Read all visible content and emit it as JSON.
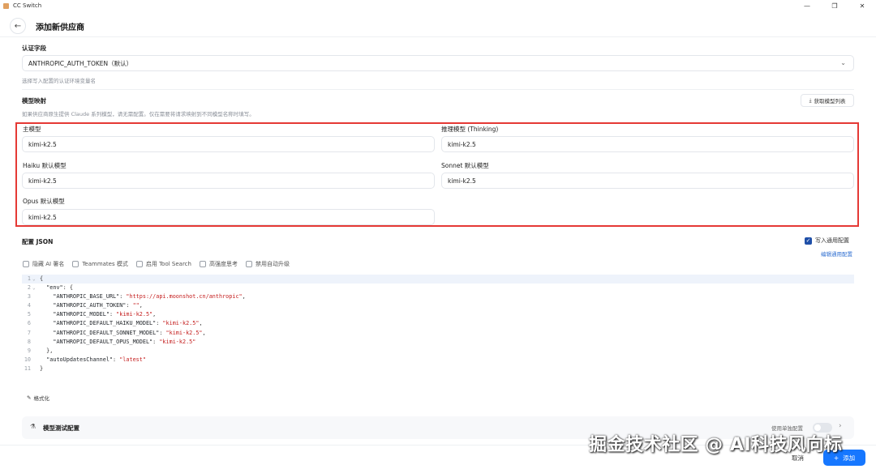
{
  "window": {
    "title": "CC Switch",
    "minimize": "—",
    "restore": "❐",
    "close": "✕"
  },
  "header": {
    "back_icon": "←",
    "title": "添加新供应商"
  },
  "auth": {
    "label": "认证字段",
    "selected": "ANTHROPIC_AUTH_TOKEN（默认）",
    "hint": "选择写入配置的认证环境变量名"
  },
  "mapping": {
    "label": "模型映射",
    "hint": "如果供应商原生提供 Claude 系列模型，请无需配置。仅在需要将请求映射到不同模型名称时填写。",
    "fetch_button": "获取模型列表",
    "fields": {
      "main": {
        "label": "主模型",
        "value": "kimi-k2.5"
      },
      "reasoning": {
        "label": "推理模型 (Thinking)",
        "value": "kimi-k2.5"
      },
      "haiku": {
        "label": "Haiku 默认模型",
        "value": "kimi-k2.5"
      },
      "sonnet": {
        "label": "Sonnet 默认模型",
        "value": "kimi-k2.5"
      },
      "opus": {
        "label": "Opus 默认模型",
        "value": "kimi-k2.5"
      }
    }
  },
  "config": {
    "label": "配置 JSON",
    "write_common": "写入通用配置",
    "edit_common": "编辑通用配置",
    "options": [
      "隐藏 AI 署名",
      "Teammates 模式",
      "启用 Tool Search",
      "高强度思考",
      "禁用自动升级"
    ],
    "code_lines": [
      {
        "n": "1",
        "fold": "⌄",
        "parts": [
          [
            "p",
            "{"
          ]
        ]
      },
      {
        "n": "2",
        "fold": "⌄",
        "parts": [
          [
            "p",
            "  "
          ],
          [
            "k",
            "\"env\""
          ],
          [
            "p",
            ": {"
          ]
        ]
      },
      {
        "n": "3",
        "fold": "",
        "parts": [
          [
            "p",
            "    "
          ],
          [
            "k",
            "\"ANTHROPIC_BASE_URL\""
          ],
          [
            "p",
            ": "
          ],
          [
            "s",
            "\"https://api.moonshot.cn/anthropic\""
          ],
          [
            "p",
            ","
          ]
        ]
      },
      {
        "n": "4",
        "fold": "",
        "parts": [
          [
            "p",
            "    "
          ],
          [
            "k",
            "\"ANTHROPIC_AUTH_TOKEN\""
          ],
          [
            "p",
            ": "
          ],
          [
            "s",
            "\"\""
          ],
          [
            "p",
            ","
          ]
        ]
      },
      {
        "n": "5",
        "fold": "",
        "parts": [
          [
            "p",
            "    "
          ],
          [
            "k",
            "\"ANTHROPIC_MODEL\""
          ],
          [
            "p",
            ": "
          ],
          [
            "s",
            "\"kimi-k2.5\""
          ],
          [
            "p",
            ","
          ]
        ]
      },
      {
        "n": "6",
        "fold": "",
        "parts": [
          [
            "p",
            "    "
          ],
          [
            "k",
            "\"ANTHROPIC_DEFAULT_HAIKU_MODEL\""
          ],
          [
            "p",
            ": "
          ],
          [
            "s",
            "\"kimi-k2.5\""
          ],
          [
            "p",
            ","
          ]
        ]
      },
      {
        "n": "7",
        "fold": "",
        "parts": [
          [
            "p",
            "    "
          ],
          [
            "k",
            "\"ANTHROPIC_DEFAULT_SONNET_MODEL\""
          ],
          [
            "p",
            ": "
          ],
          [
            "s",
            "\"kimi-k2.5\""
          ],
          [
            "p",
            ","
          ]
        ]
      },
      {
        "n": "8",
        "fold": "",
        "parts": [
          [
            "p",
            "    "
          ],
          [
            "k",
            "\"ANTHROPIC_DEFAULT_OPUS_MODEL\""
          ],
          [
            "p",
            ": "
          ],
          [
            "s",
            "\"kimi-k2.5\""
          ]
        ]
      },
      {
        "n": "9",
        "fold": "",
        "parts": [
          [
            "p",
            "  },"
          ]
        ]
      },
      {
        "n": "10",
        "fold": "",
        "parts": [
          [
            "p",
            "  "
          ],
          [
            "k",
            "\"autoUpdatesChannel\""
          ],
          [
            "p",
            ": "
          ],
          [
            "s",
            "\"latest\""
          ]
        ]
      },
      {
        "n": "11",
        "fold": "",
        "parts": [
          [
            "p",
            "}"
          ]
        ]
      }
    ],
    "format_button": "格式化"
  },
  "test": {
    "title": "模型测试配置",
    "single_config": "使用单独配置"
  },
  "footer": {
    "cancel": "取消",
    "add": "添加",
    "add_icon": "+"
  },
  "watermark": "掘金技术社区 @ AI科技风向标",
  "colors": {
    "highlight_border": "#e53935",
    "primary": "#1677ff",
    "link": "#2f6fd1"
  }
}
